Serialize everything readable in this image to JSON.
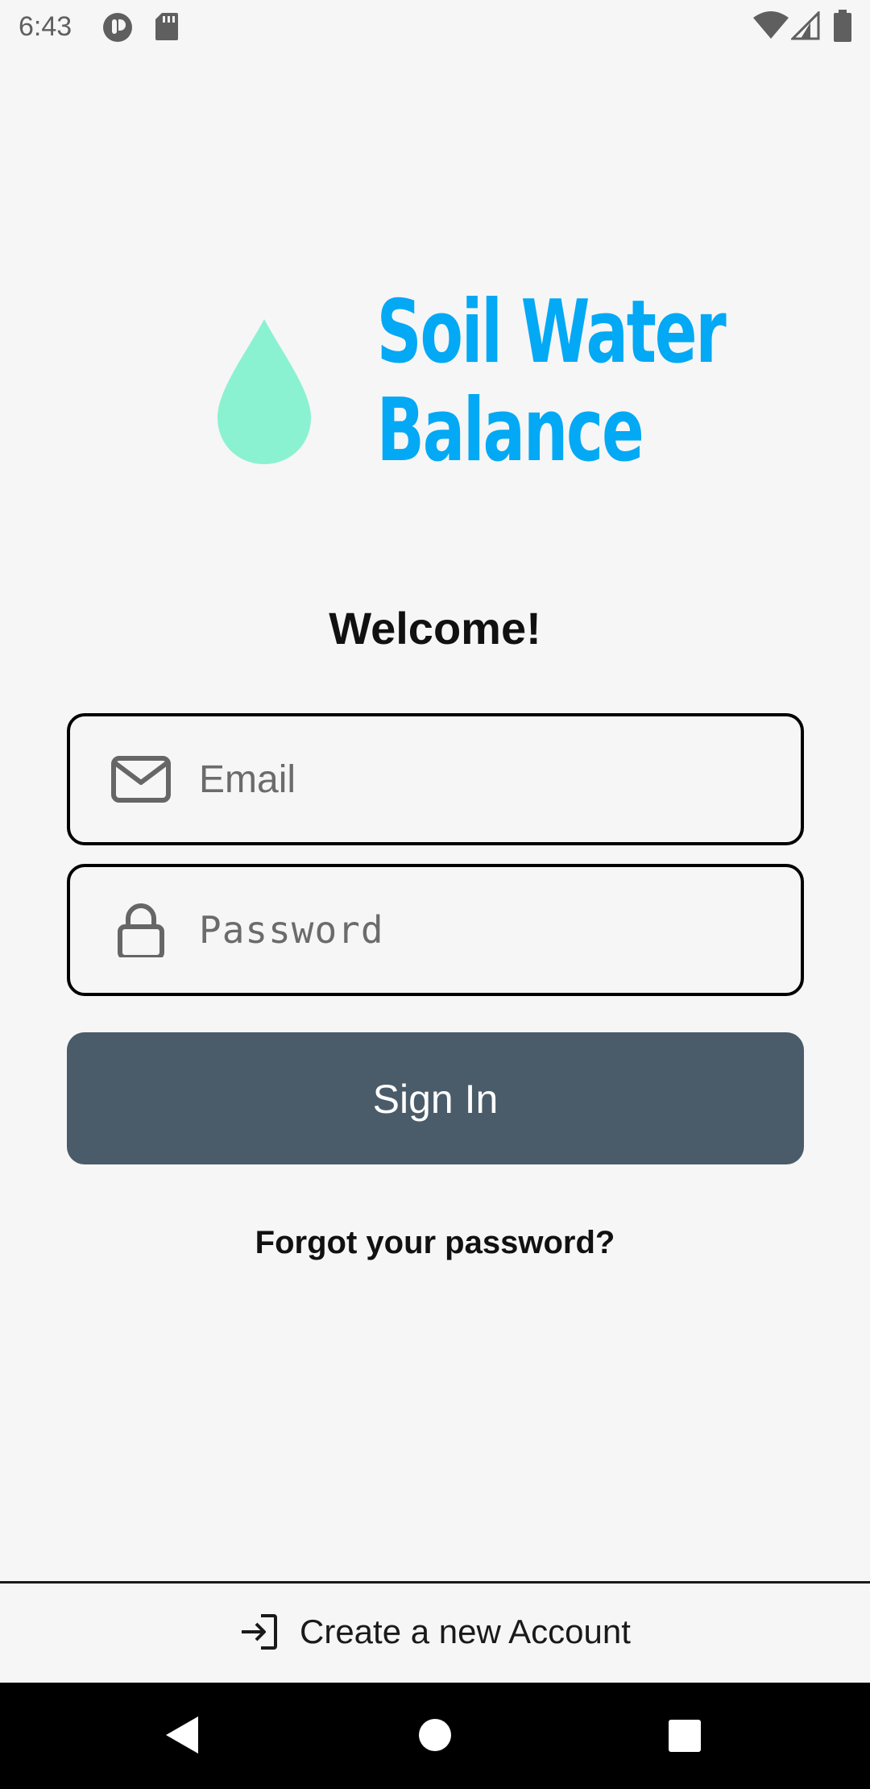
{
  "status_bar": {
    "time": "6:43",
    "icons": [
      "notification-app-icon",
      "sd-card-icon",
      "wifi-icon",
      "cellular-signal-icon",
      "battery-icon"
    ]
  },
  "logo": {
    "line1": "Soil Water",
    "line2": "Balance",
    "text_color": "#03a9f4",
    "drop_color": "#8af2d0"
  },
  "welcome": "Welcome!",
  "email": {
    "placeholder": "Email",
    "value": "",
    "icon": "mail-icon"
  },
  "password": {
    "placeholder": "Password",
    "value": "",
    "icon": "lock-icon"
  },
  "signin": {
    "label": "Sign In",
    "color": "#4a5c6a"
  },
  "forgot": "Forgot your password?",
  "create_account": {
    "label": "Create a new Account",
    "icon": "login-arrow-icon"
  },
  "nav": {
    "buttons": [
      "back-icon",
      "home-icon",
      "recents-icon"
    ]
  }
}
